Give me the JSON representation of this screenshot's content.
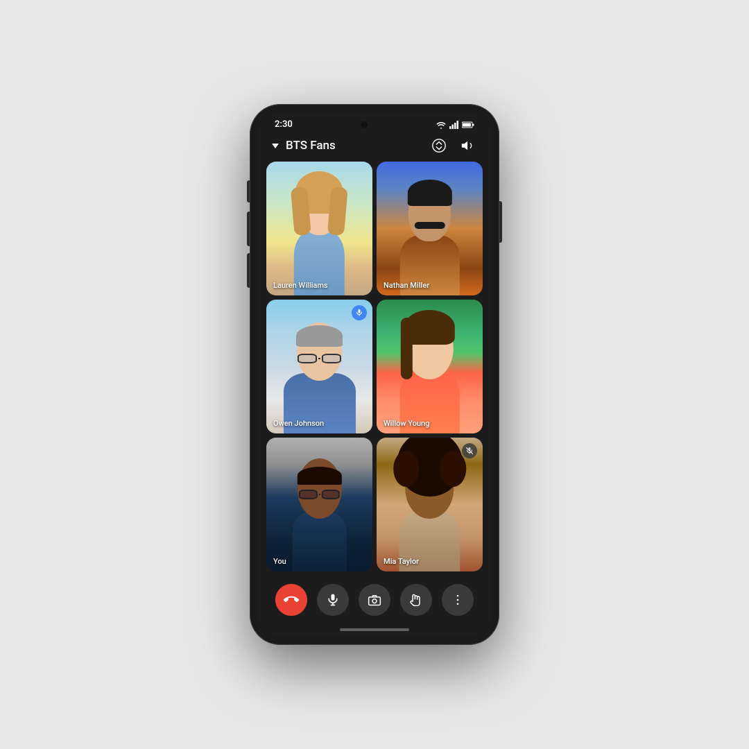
{
  "phone": {
    "status_bar": {
      "time": "2:30",
      "wifi_icon": "wifi",
      "signal_icon": "signal",
      "battery_icon": "battery"
    },
    "header": {
      "title": "BTS Fans",
      "chevron": "▾",
      "camera_flip_icon": "camera-flip",
      "speaker_icon": "speaker"
    },
    "participants": [
      {
        "id": "lauren",
        "name": "Lauren Williams",
        "muted": false,
        "speaking": false,
        "tile_class": "lauren-photo"
      },
      {
        "id": "nathan",
        "name": "Nathan Miller",
        "muted": false,
        "speaking": false,
        "tile_class": "nathan-photo"
      },
      {
        "id": "owen",
        "name": "Owen Johnson",
        "muted": false,
        "speaking": true,
        "tile_class": "owen-photo"
      },
      {
        "id": "willow",
        "name": "Willow Young",
        "muted": false,
        "speaking": false,
        "tile_class": "willow-photo"
      },
      {
        "id": "you",
        "name": "You",
        "muted": false,
        "speaking": false,
        "tile_class": "you-photo"
      },
      {
        "id": "mia",
        "name": "Mia Taylor",
        "muted": true,
        "speaking": false,
        "tile_class": "mia-photo"
      }
    ],
    "controls": [
      {
        "id": "end-call",
        "icon": "phone-end",
        "color": "#ea4335",
        "label": "End call"
      },
      {
        "id": "mute",
        "icon": "microphone",
        "color": "#3a3a3a",
        "label": "Mute"
      },
      {
        "id": "camera",
        "icon": "camera",
        "color": "#3a3a3a",
        "label": "Camera"
      },
      {
        "id": "raise-hand",
        "icon": "hand",
        "color": "#3a3a3a",
        "label": "Raise hand"
      },
      {
        "id": "more",
        "icon": "more-vertical",
        "color": "#3a3a3a",
        "label": "More options"
      }
    ]
  }
}
